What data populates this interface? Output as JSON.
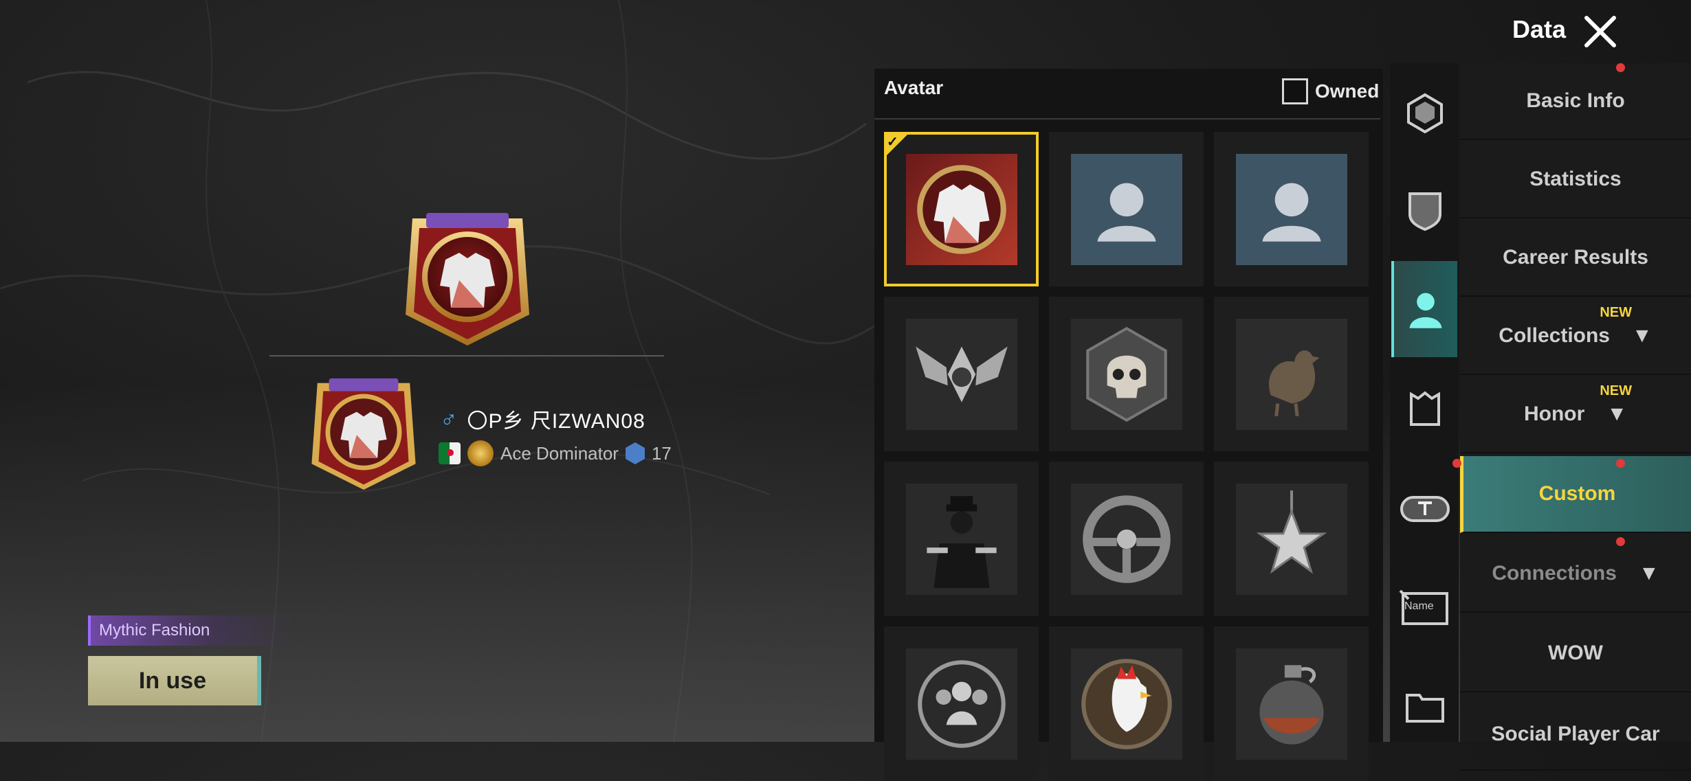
{
  "header": {
    "title": "Data"
  },
  "preview": {
    "player_name": "〇P乡 尺IZWAN08",
    "title": "Ace Dominator",
    "level": "17",
    "fashion_tag": "Mythic Fashion",
    "in_use_label": "In use"
  },
  "avatar_panel": {
    "title": "Avatar",
    "owned_label": "Owned",
    "items": [
      {
        "icon": "jacket-avatar-icon",
        "selected": true
      },
      {
        "icon": "default-person-avatar-icon"
      },
      {
        "icon": "default-person-avatar-icon"
      },
      {
        "icon": "winged-emblem-avatar-icon"
      },
      {
        "icon": "skull-avatar-icon"
      },
      {
        "icon": "chicken-avatar-icon"
      },
      {
        "icon": "gunman-avatar-icon"
      },
      {
        "icon": "steering-wheel-avatar-icon"
      },
      {
        "icon": "star-medal-avatar-icon"
      },
      {
        "icon": "squad-avatar-icon"
      },
      {
        "icon": "rooster-avatar-icon"
      },
      {
        "icon": "grenade-avatar-icon"
      }
    ]
  },
  "side_icons": [
    "frame-icon",
    "shield-icon",
    "avatar-person-icon",
    "banner-icon",
    "title-tag-icon",
    "name-card-icon",
    "folder-icon"
  ],
  "menu": {
    "basic_info": "Basic Info",
    "statistics": "Statistics",
    "career_results": "Career Results",
    "collections": "Collections",
    "honor": "Honor",
    "custom": "Custom",
    "connections": "Connections",
    "wow": "WOW",
    "social": "Social Player Car",
    "new_badge": "NEW",
    "name_card_label": "Name"
  },
  "colors": {
    "accent": "#f2cc2c",
    "active_teal": "#3b7c78",
    "notification": "#e23a3a"
  }
}
